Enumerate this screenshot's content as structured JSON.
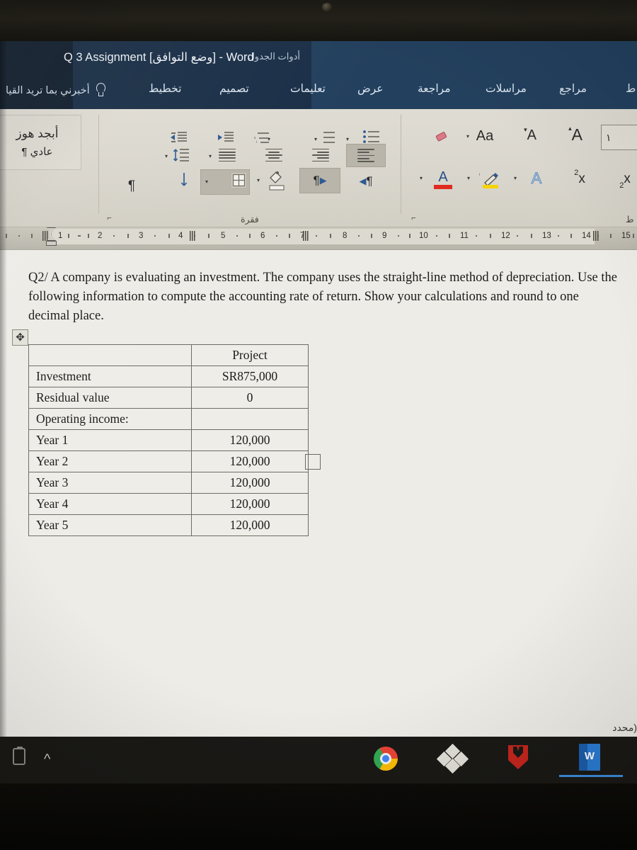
{
  "window": {
    "title": "Q 3 Assignment [وضع التوافق]  -  Word",
    "contextual_tools_label": "أدوات الجدول",
    "accent_color": "#23405e",
    "contextual_color": "#1b3048"
  },
  "tellme": {
    "text": "أخبرني بما تريد القيا",
    "icon": "lightbulb-icon"
  },
  "tabs": [
    {
      "label": "تخطيط",
      "contextual": true,
      "active": false
    },
    {
      "label": "تصميم",
      "contextual": true,
      "active": false
    },
    {
      "label": "تعليمات",
      "contextual": false,
      "active": false
    },
    {
      "label": "عرض",
      "contextual": false,
      "active": false
    },
    {
      "label": "مراجعة",
      "contextual": false,
      "active": false
    },
    {
      "label": "مراسلات",
      "contextual": false,
      "active": false
    },
    {
      "label": "مراجع",
      "contextual": false,
      "active": false
    },
    {
      "label": "ط",
      "contextual": false,
      "active": false
    }
  ],
  "ribbon": {
    "groups": [
      {
        "name": "styles",
        "title": ""
      },
      {
        "name": "paragraph",
        "title": "فقرة"
      },
      {
        "name": "font",
        "title": "ط"
      }
    ],
    "styles_gallery": {
      "sample": "أبجد هوز",
      "style_name": "عادي ¶"
    },
    "paragraph_buttons": [
      {
        "name": "increase-indent-icon",
        "label": "زيادة المسافة البادئة"
      },
      {
        "name": "decrease-indent-icon",
        "label": "إنقاص المسافة البادئة"
      },
      {
        "name": "multilevel-list-icon",
        "label": "قائمة متعددة المستويات"
      },
      {
        "name": "numbered-list-icon",
        "label": "ترقيم"
      },
      {
        "name": "bulleted-list-icon",
        "label": "تعداد نقطي"
      },
      {
        "name": "line-spacing-icon",
        "label": "تباعد الأسطر"
      },
      {
        "name": "align-justify-icon",
        "label": "ضبط"
      },
      {
        "name": "align-center-icon",
        "label": "توسيط"
      },
      {
        "name": "align-left-icon",
        "label": "محاذاة لليسار"
      },
      {
        "name": "align-right-icon",
        "label": "محاذاة لليمين"
      },
      {
        "name": "sort-icon",
        "label": "فرز"
      },
      {
        "name": "borders-icon",
        "label": "الحدود"
      },
      {
        "name": "shading-icon",
        "label": "تظليل"
      },
      {
        "name": "ltr-text-direction-icon",
        "label": "اتجاه النص من اليسار لليمين"
      },
      {
        "name": "rtl-text-direction-icon",
        "label": "اتجاه النص من اليمين لليسار"
      }
    ],
    "font_buttons": [
      {
        "name": "clear-formatting-icon",
        "label": "مسح التنسيق"
      },
      {
        "name": "change-case-icon",
        "label": "Aa"
      },
      {
        "name": "shrink-font-icon",
        "label": "A"
      },
      {
        "name": "grow-font-icon",
        "label": "A"
      },
      {
        "name": "font-color-icon",
        "label": "لون الخط"
      },
      {
        "name": "text-highlight-icon",
        "label": "aby"
      },
      {
        "name": "text-effects-icon",
        "label": "A"
      },
      {
        "name": "superscript-icon",
        "label": "x²"
      },
      {
        "name": "subscript-icon",
        "label": "x₂"
      }
    ],
    "font_size_box": {
      "value": "١"
    }
  },
  "ruler": {
    "ticks": [
      "1",
      "2",
      "3",
      "4",
      "5",
      "6",
      "7",
      "8",
      "9",
      "10",
      "11",
      "12",
      "13",
      "14",
      "15"
    ]
  },
  "document": {
    "paragraph": "Q2/ A company is evaluating an investment. The company uses the straight-line method of depreciation. Use the following information to compute the accounting rate of return.  Show your calculations and round to one decimal place.",
    "table": {
      "header": [
        "",
        "Project"
      ],
      "rows": [
        {
          "label": "Investment",
          "value": "SR875,000"
        },
        {
          "label": "Residual value",
          "value": "0"
        },
        {
          "label": "Operating income:",
          "value": ""
        },
        {
          "label": "Year 1",
          "value": "120,000"
        },
        {
          "label": "Year 2",
          "value": "120,000"
        },
        {
          "label": "Year 3",
          "value": "120,000"
        },
        {
          "label": "Year 4",
          "value": "120,000"
        },
        {
          "label": "Year 5",
          "value": "120,000"
        }
      ]
    },
    "status_note": "(محدد"
  },
  "taskbar": {
    "items": [
      {
        "name": "tray-battery-icon",
        "label": "البطارية"
      },
      {
        "name": "tray-chevron-icon",
        "label": "إظهار الأيقونات المخفية"
      },
      {
        "name": "chrome-taskbar-icon",
        "label": "Google Chrome"
      },
      {
        "name": "dropbox-taskbar-icon",
        "label": "Dropbox"
      },
      {
        "name": "shield-taskbar-icon",
        "label": "Antivirus"
      },
      {
        "name": "word-taskbar-icon",
        "label": "W"
      }
    ]
  }
}
